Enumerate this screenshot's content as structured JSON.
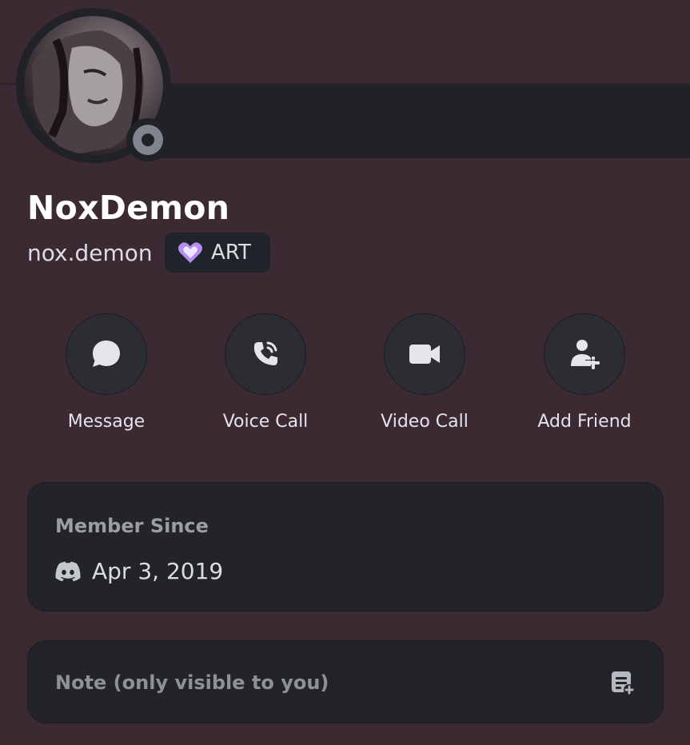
{
  "profile": {
    "display_name": "NoxDemon",
    "username": "nox.demon",
    "status": "offline",
    "tag": {
      "icon": "heart-badge-icon",
      "label": "ART",
      "icon_color": "#b58cf2"
    }
  },
  "actions": [
    {
      "id": "message",
      "label": "Message",
      "icon": "chat-bubble-icon"
    },
    {
      "id": "voice",
      "label": "Voice Call",
      "icon": "phone-icon"
    },
    {
      "id": "video",
      "label": "Video Call",
      "icon": "video-camera-icon"
    },
    {
      "id": "add_friend",
      "label": "Add Friend",
      "icon": "add-friend-icon"
    }
  ],
  "member_since": {
    "title": "Member Since",
    "icon": "discord-logo-icon",
    "date": "Apr 3, 2019"
  },
  "note": {
    "placeholder": "Note (only visible to you)",
    "icon": "note-add-icon"
  },
  "colors": {
    "background": "#3c2a33",
    "card": "#232428",
    "button": "#2b2d31",
    "status_offline": "#80848e"
  }
}
